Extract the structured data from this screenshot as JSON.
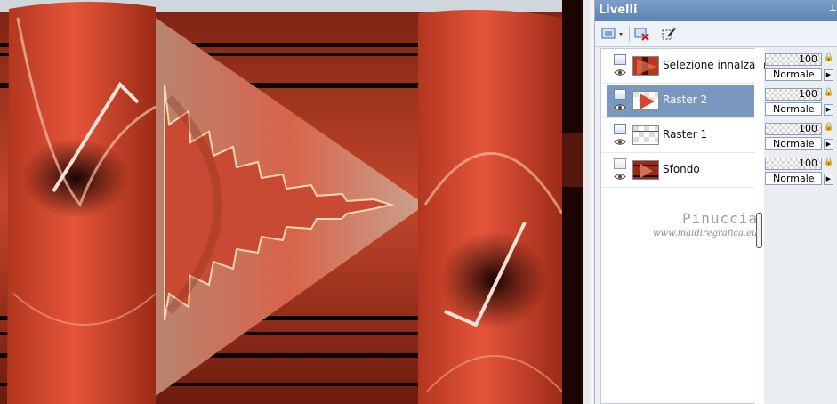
{
  "panel": {
    "title": "Livelli"
  },
  "toolbar": {
    "buttons": [
      "new-layer",
      "delete-layer",
      "edit-selection"
    ]
  },
  "layers": [
    {
      "name": "Selezione innalzata",
      "opacity": "100",
      "blend": "Normale",
      "selected": false
    },
    {
      "name": "Raster 2",
      "opacity": "100",
      "blend": "Normale",
      "selected": true
    },
    {
      "name": "Raster 1",
      "opacity": "100",
      "blend": "Normale",
      "selected": false
    },
    {
      "name": "Sfondo",
      "opacity": "100",
      "blend": "Normale",
      "selected": false
    }
  ],
  "watermark": {
    "title": "Pinuccia",
    "url": "www.maidiregrafica.eu"
  },
  "colors": {
    "accent": "#5b82b4",
    "selected_row": "#7a98bf",
    "canvas_red": "#d8432a"
  }
}
